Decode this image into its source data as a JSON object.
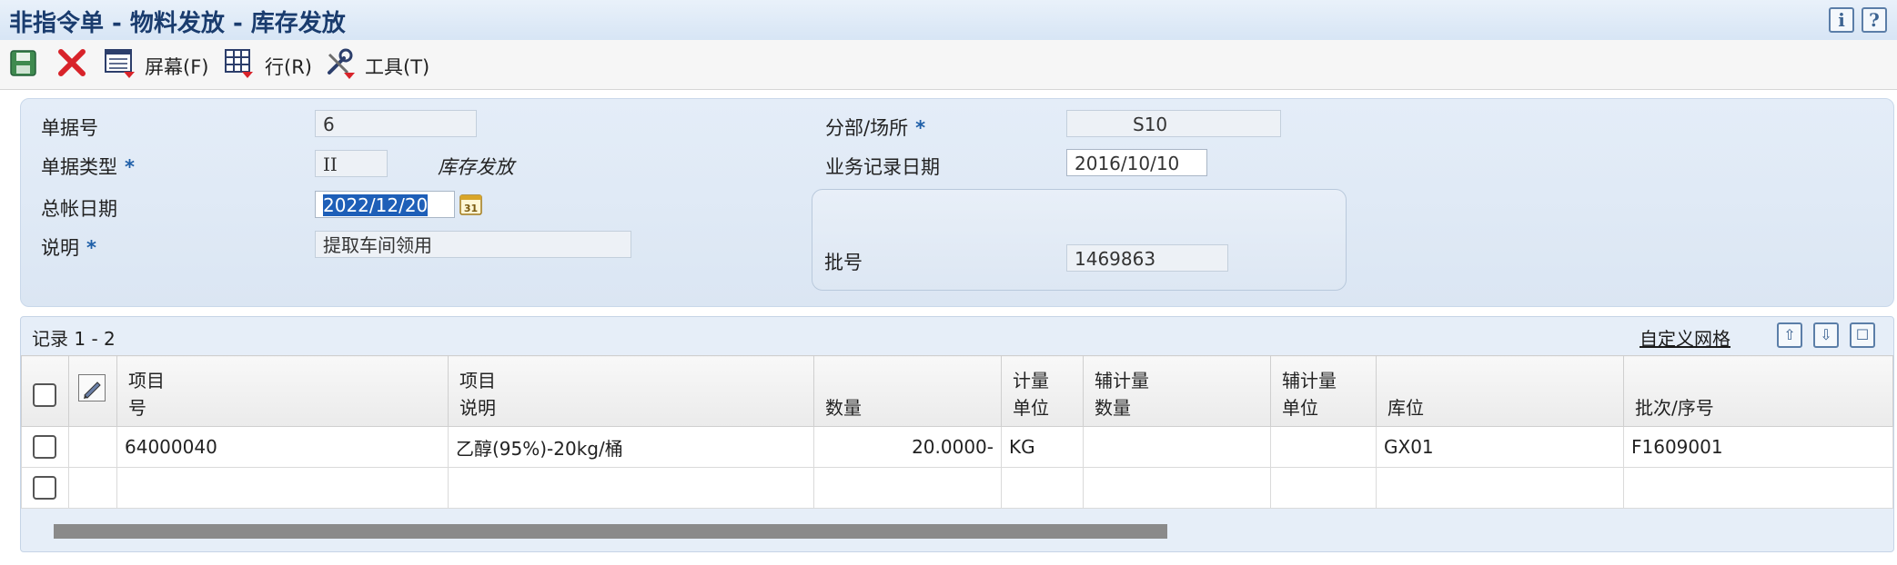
{
  "window": {
    "title": "非指令单 - 物料发放 - 库存发放"
  },
  "title_icons": {
    "info": "i",
    "help": "?"
  },
  "toolbar": {
    "screen_label": "屏幕(F)",
    "row_label": "行(R)",
    "tools_label": "工具(T)"
  },
  "form": {
    "doc_no": {
      "label": "单据号",
      "value": "6"
    },
    "doc_type": {
      "label": "单据类型",
      "value": "II",
      "description": "库存发放"
    },
    "gl_date": {
      "label": "总帐日期",
      "value": "2022/12/20"
    },
    "explanation": {
      "label": "说明",
      "value": "提取车间领用"
    },
    "branch_plant": {
      "label": "分部/场所",
      "value": "S10"
    },
    "transaction_date": {
      "label": "业务记录日期",
      "value": "2016/10/10"
    },
    "batch_no": {
      "label": "批号",
      "value": "1469863"
    },
    "required_mark": "*",
    "calendar_glyph": "31"
  },
  "grid": {
    "caption": "记录 1 - 2",
    "customize_link": "自定义网格",
    "headers": {
      "item_no": [
        "项目",
        "号"
      ],
      "description": [
        "项目",
        "说明"
      ],
      "quantity": "数量",
      "uom": [
        "计量",
        "单位"
      ],
      "sec_qty": [
        "辅计量",
        "数量"
      ],
      "sec_uom": [
        "辅计量",
        "单位"
      ],
      "location": "库位",
      "lot_serial": "批次/序号"
    },
    "rows": [
      {
        "item_no": "64000040",
        "description": "乙醇(95%)-20kg/桶",
        "quantity": "20.0000-",
        "uom": "KG",
        "sec_qty": "",
        "sec_uom": "",
        "location": "GX01",
        "lot_serial": "F1609001"
      },
      {
        "item_no": "",
        "description": "",
        "quantity": "",
        "uom": "",
        "sec_qty": "",
        "sec_uom": "",
        "location": "",
        "lot_serial": ""
      }
    ]
  },
  "colors": {
    "title_text": "#1a3c6e",
    "required": "#1f5fa8",
    "selection": "#1e5fb8",
    "panel_bg": "#dfe9f5"
  }
}
